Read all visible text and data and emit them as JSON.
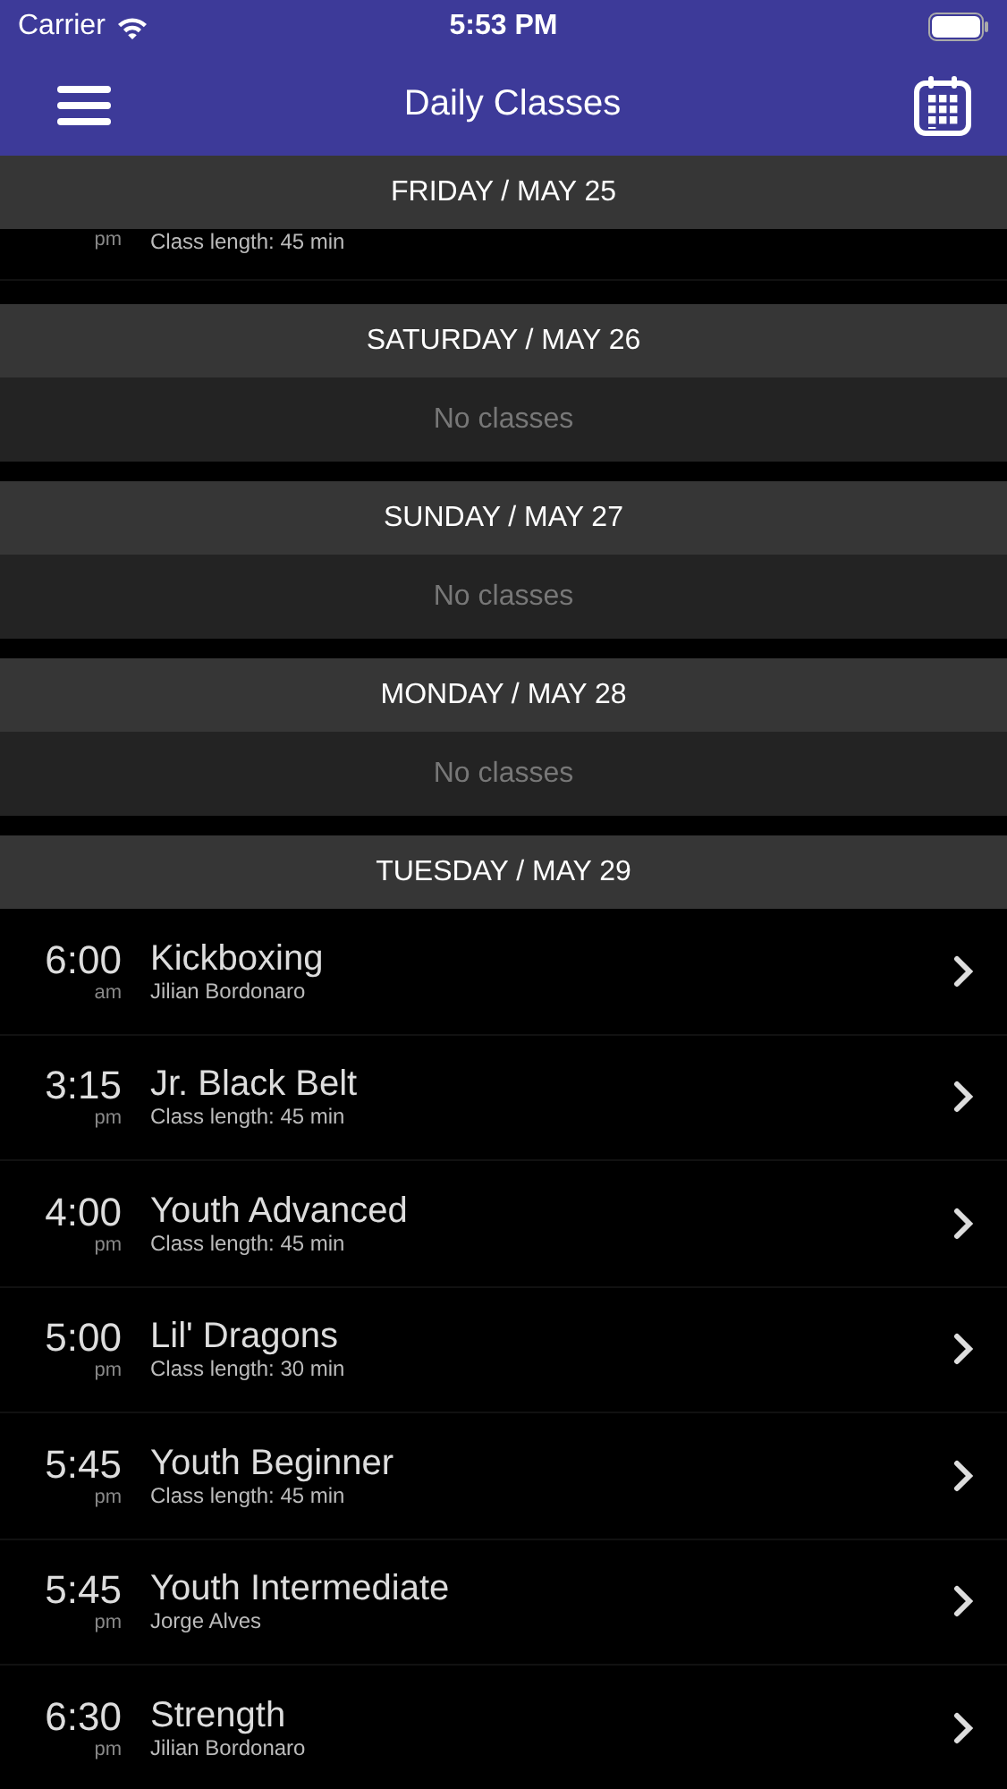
{
  "status_bar": {
    "carrier": "Carrier",
    "time": "5:53 PM"
  },
  "nav": {
    "title": "Daily Classes"
  },
  "days": [
    {
      "heading": "FRIDAY / MAY 25",
      "classes": [
        {
          "period": "pm",
          "detail": "Class length: 45 min"
        }
      ]
    },
    {
      "heading": "SATURDAY / MAY 26",
      "empty_text": "No classes"
    },
    {
      "heading": "SUNDAY / MAY 27",
      "empty_text": "No classes"
    },
    {
      "heading": "MONDAY / MAY 28",
      "empty_text": "No classes"
    },
    {
      "heading": "TUESDAY / MAY 29",
      "classes": [
        {
          "time": "6:00",
          "period": "am",
          "name": "Kickboxing",
          "detail": "Jilian Bordonaro"
        },
        {
          "time": "3:15",
          "period": "pm",
          "name": "Jr. Black Belt",
          "detail": "Class length: 45 min"
        },
        {
          "time": "4:00",
          "period": "pm",
          "name": "Youth Advanced",
          "detail": "Class length: 45 min"
        },
        {
          "time": "5:00",
          "period": "pm",
          "name": "Lil' Dragons",
          "detail": "Class length: 30 min"
        },
        {
          "time": "5:45",
          "period": "pm",
          "name": "Youth Beginner",
          "detail": "Class length: 45 min"
        },
        {
          "time": "5:45",
          "period": "pm",
          "name": "Youth Intermediate",
          "detail": "Jorge Alves"
        },
        {
          "time": "6:30",
          "period": "pm",
          "name": "Strength",
          "detail": "Jilian Bordonaro"
        }
      ]
    }
  ]
}
